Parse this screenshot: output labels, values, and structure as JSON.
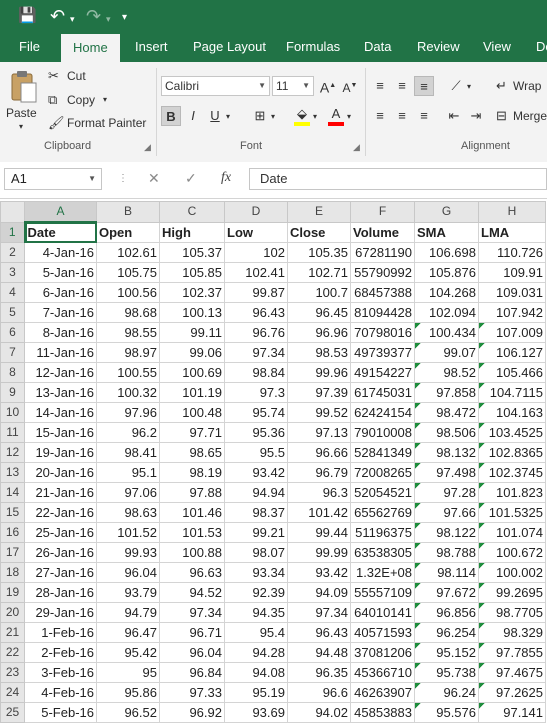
{
  "qat": {
    "save": "💾",
    "undo": "↶",
    "redo": "↷",
    "more": "▾"
  },
  "tabs": [
    "File",
    "Home",
    "Insert",
    "Page Layout",
    "Formulas",
    "Data",
    "Review",
    "View",
    "De"
  ],
  "active_tab": "Home",
  "clipboard": {
    "paste": "Paste",
    "cut": "Cut",
    "copy": "Copy",
    "format_painter": "Format Painter",
    "group": "Clipboard"
  },
  "font": {
    "name": "Calibri",
    "size": "11",
    "bold": "B",
    "italic": "I",
    "underline": "U",
    "group": "Font"
  },
  "alignment": {
    "wrap": "Wrap",
    "merge": "Merge",
    "group": "Alignment"
  },
  "formula_bar": {
    "name_box": "A1",
    "cancel": "✕",
    "enter": "✓",
    "fx": "fx",
    "content": "Date"
  },
  "columns": [
    "A",
    "B",
    "C",
    "D",
    "E",
    "F",
    "G",
    "H"
  ],
  "headers": [
    "Date",
    "Open",
    "High",
    "Low",
    "Close",
    "Volume",
    "SMA",
    "LMA"
  ],
  "rows": [
    [
      "4-Jan-16",
      "102.61",
      "105.37",
      "102",
      "105.35",
      "67281190",
      "106.698",
      "110.726"
    ],
    [
      "5-Jan-16",
      "105.75",
      "105.85",
      "102.41",
      "102.71",
      "55790992",
      "105.876",
      "109.91"
    ],
    [
      "6-Jan-16",
      "100.56",
      "102.37",
      "99.87",
      "100.7",
      "68457388",
      "104.268",
      "109.031"
    ],
    [
      "7-Jan-16",
      "98.68",
      "100.13",
      "96.43",
      "96.45",
      "81094428",
      "102.094",
      "107.942"
    ],
    [
      "8-Jan-16",
      "98.55",
      "99.11",
      "96.76",
      "96.96",
      "70798016",
      "100.434",
      "107.009"
    ],
    [
      "11-Jan-16",
      "98.97",
      "99.06",
      "97.34",
      "98.53",
      "49739377",
      "99.07",
      "106.127"
    ],
    [
      "12-Jan-16",
      "100.55",
      "100.69",
      "98.84",
      "99.96",
      "49154227",
      "98.52",
      "105.466"
    ],
    [
      "13-Jan-16",
      "100.32",
      "101.19",
      "97.3",
      "97.39",
      "61745031",
      "97.858",
      "104.7115"
    ],
    [
      "14-Jan-16",
      "97.96",
      "100.48",
      "95.74",
      "99.52",
      "62424154",
      "98.472",
      "104.163"
    ],
    [
      "15-Jan-16",
      "96.2",
      "97.71",
      "95.36",
      "97.13",
      "79010008",
      "98.506",
      "103.4525"
    ],
    [
      "19-Jan-16",
      "98.41",
      "98.65",
      "95.5",
      "96.66",
      "52841349",
      "98.132",
      "102.8365"
    ],
    [
      "20-Jan-16",
      "95.1",
      "98.19",
      "93.42",
      "96.79",
      "72008265",
      "97.498",
      "102.3745"
    ],
    [
      "21-Jan-16",
      "97.06",
      "97.88",
      "94.94",
      "96.3",
      "52054521",
      "97.28",
      "101.823"
    ],
    [
      "22-Jan-16",
      "98.63",
      "101.46",
      "98.37",
      "101.42",
      "65562769",
      "97.66",
      "101.5325"
    ],
    [
      "25-Jan-16",
      "101.52",
      "101.53",
      "99.21",
      "99.44",
      "51196375",
      "98.122",
      "101.074"
    ],
    [
      "26-Jan-16",
      "99.93",
      "100.88",
      "98.07",
      "99.99",
      "63538305",
      "98.788",
      "100.672"
    ],
    [
      "27-Jan-16",
      "96.04",
      "96.63",
      "93.34",
      "93.42",
      "1.32E+08",
      "98.114",
      "100.002"
    ],
    [
      "28-Jan-16",
      "93.79",
      "94.52",
      "92.39",
      "94.09",
      "55557109",
      "97.672",
      "99.2695"
    ],
    [
      "29-Jan-16",
      "94.79",
      "97.34",
      "94.35",
      "97.34",
      "64010141",
      "96.856",
      "98.7705"
    ],
    [
      "1-Feb-16",
      "96.47",
      "96.71",
      "95.4",
      "96.43",
      "40571593",
      "96.254",
      "98.329"
    ],
    [
      "2-Feb-16",
      "95.42",
      "96.04",
      "94.28",
      "94.48",
      "37081206",
      "95.152",
      "97.7855"
    ],
    [
      "3-Feb-16",
      "95",
      "96.84",
      "94.08",
      "96.35",
      "45366710",
      "95.738",
      "97.4675"
    ],
    [
      "4-Feb-16",
      "95.86",
      "97.33",
      "95.19",
      "96.6",
      "46263907",
      "96.24",
      "97.2625"
    ],
    [
      "5-Feb-16",
      "96.52",
      "96.92",
      "93.69",
      "94.02",
      "45853883",
      "95.576",
      "97.141"
    ]
  ],
  "flagged_cols": [
    "G",
    "H"
  ]
}
